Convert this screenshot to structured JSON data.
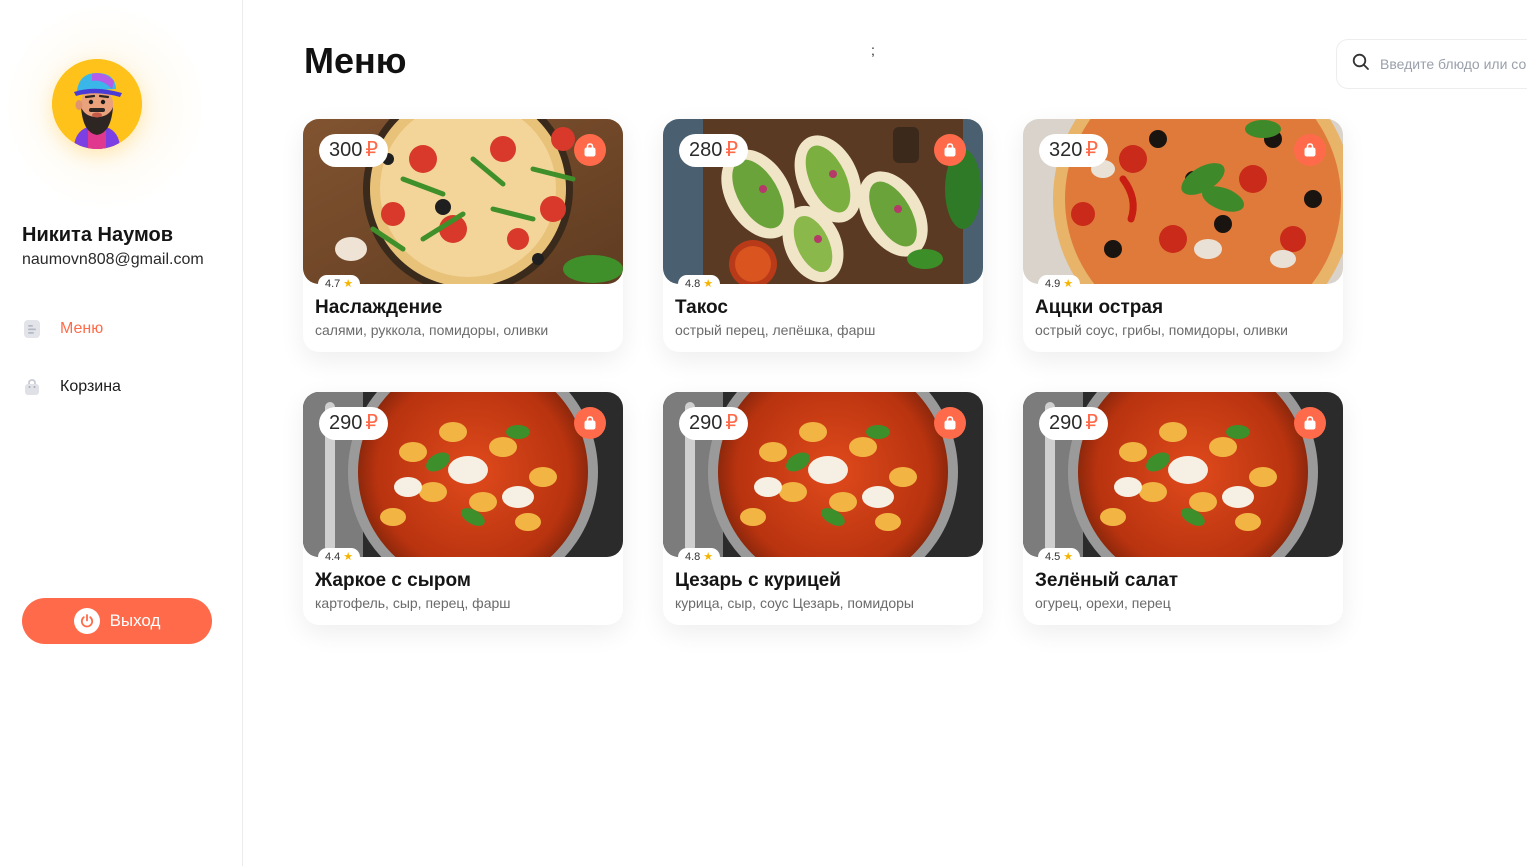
{
  "colors": {
    "accent": "#ff6b4a",
    "avatar_bg": "#ffc21a",
    "star": "#f5b400"
  },
  "user": {
    "name": "Никита Наумов",
    "email": "naumovn808@gmail.com",
    "avatar_icon": "bearded-man-avatar"
  },
  "sidebar": {
    "items": [
      {
        "label": "Меню",
        "icon": "document-icon",
        "active": true
      },
      {
        "label": "Корзина",
        "icon": "bag-icon",
        "active": false
      }
    ],
    "logout_label": "Выход",
    "logout_icon": "power-icon"
  },
  "main": {
    "title": "Меню",
    "stray_text": ";",
    "search": {
      "placeholder": "Введите блюдо или со",
      "icon": "search-icon"
    }
  },
  "currency": "₽",
  "products": [
    {
      "price": "300",
      "rating": "4.7",
      "title": "Наслаждение",
      "desc": "салями, руккола, помидоры, оливки",
      "image": "pizza-arugula"
    },
    {
      "price": "280",
      "rating": "4.8",
      "title": "Такос",
      "desc": "острый перец, лепёшка, фарш",
      "image": "tacos"
    },
    {
      "price": "320",
      "rating": "4.9",
      "title": "Аццки острая",
      "desc": "острый соус, грибы, помидоры, оливки",
      "image": "pizza-spicy"
    },
    {
      "price": "290",
      "rating": "4.4",
      "title": "Жаркое с сыром",
      "desc": "картофель, сыр, перец, фарш",
      "image": "gnocchi-pan"
    },
    {
      "price": "290",
      "rating": "4.8",
      "title": "Цезарь с курицей",
      "desc": "курица, сыр, соус Цезарь, помидоры",
      "image": "gnocchi-pan"
    },
    {
      "price": "290",
      "rating": "4.5",
      "title": "Зелёный салат",
      "desc": "огурец, орехи, перец",
      "image": "gnocchi-pan"
    }
  ]
}
